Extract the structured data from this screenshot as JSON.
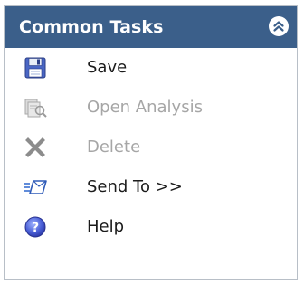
{
  "panel": {
    "title": "Common Tasks",
    "collapse_icon": "double-chevron-up-icon"
  },
  "tasks": [
    {
      "label": "Save",
      "icon": "floppy-disk-icon",
      "enabled": true
    },
    {
      "label": "Open Analysis",
      "icon": "open-analysis-icon",
      "enabled": false
    },
    {
      "label": "Delete",
      "icon": "delete-x-icon",
      "enabled": false
    },
    {
      "label": "Send To >>",
      "icon": "send-to-icon",
      "enabled": true
    },
    {
      "label": "Help",
      "icon": "help-icon",
      "enabled": true
    }
  ],
  "colors": {
    "header_bg": "#3b5f8a",
    "header_text": "#ffffff",
    "enabled_text": "#1b1b1b",
    "disabled_text": "#a6a6a6",
    "panel_border": "#b8bfc7"
  }
}
